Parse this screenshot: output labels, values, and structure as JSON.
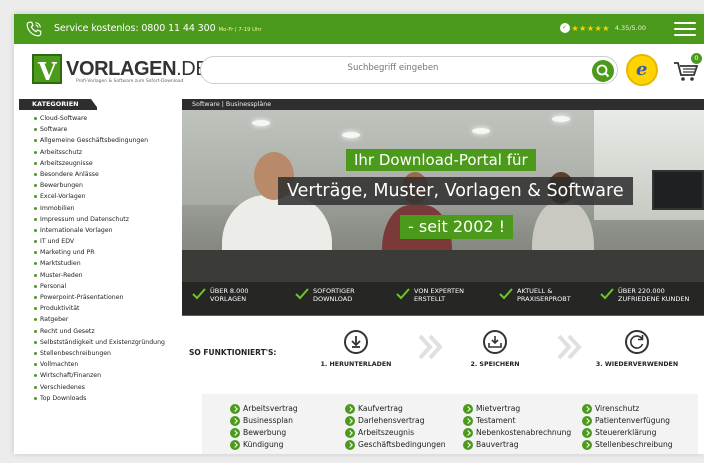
{
  "topbar": {
    "service_text": "Service kostenlos: 0800 11 44 300",
    "service_hours": "Mo-Fr | 7-19 Uhr",
    "rating_stars": "★★★★★",
    "rating_score": "4.35/5.00"
  },
  "header": {
    "logo_text": "VORLAGEN",
    "logo_tld": ".DE",
    "logo_tagline": "Profi-Vorlagen & Software zum Sofort-Download",
    "search_placeholder": "Suchbegriff eingeben",
    "trust_badge": "e",
    "cart_count": "0"
  },
  "sidebar": {
    "heading": "KATEGORIEN",
    "items": [
      "Cloud-Software",
      "Software",
      "Allgemeine Geschäftsbedingungen",
      "Arbeitsschutz",
      "Arbeitszeugnisse",
      "Besondere Anlässe",
      "Bewerbungen",
      "Excel-Vorlagen",
      "Immobilien",
      "Impressum und Datenschutz",
      "Internationale Vorlagen",
      "IT und EDV",
      "Marketing und PR",
      "Marktstudien",
      "Muster-Reden",
      "Personal",
      "Powerpoint-Präsentationen",
      "Produktivität",
      "Ratgeber",
      "Recht und Gesetz",
      "Selbstständigkeit und Existenzgründung",
      "Stellenbeschreibungen",
      "Vollmachten",
      "Wirtschaft/Finanzen",
      "Verschiedenes",
      "Top Downloads"
    ]
  },
  "breadcrumb": "Software | Businesspläne",
  "hero": {
    "line1": "Ihr Download-Portal für",
    "line2": "Verträge, Muster, Vorlagen & Software",
    "line3": "- seit 2002 !"
  },
  "usps": [
    {
      "line1": "ÜBER 8.000",
      "line2": "VORLAGEN"
    },
    {
      "line1": "SOFORTIGER",
      "line2": "DOWNLOAD"
    },
    {
      "line1": "VON EXPERTEN",
      "line2": "ERSTELLT"
    },
    {
      "line1": "AKTUELL &",
      "line2": "PRAXISERPROBT"
    },
    {
      "line1": "ÜBER 220.000",
      "line2": "ZUFRIEDENE KUNDEN"
    }
  ],
  "howto": {
    "label": "SO FUNKTIONIERT'S:",
    "steps": [
      "1. HERUNTERLADEN",
      "2. SPEICHERN",
      "3. WIEDERVERWENDEN"
    ]
  },
  "links": [
    [
      "Arbeitsvertrag",
      "Kaufvertrag",
      "Mietvertrag",
      "Virenschutz"
    ],
    [
      "Businessplan",
      "Darlehensvertrag",
      "Testament",
      "Patientenverfügung"
    ],
    [
      "Bewerbung",
      "Arbeitszeugnis",
      "Nebenkostenabrechnung",
      "Steuererklärung"
    ],
    [
      "Kündigung",
      "Geschäftsbedingungen",
      "Bauvertrag",
      "Stellenbeschreibung"
    ]
  ],
  "colors": {
    "brand_green": "#4c9a1c",
    "dark_bar": "#2e2e2e"
  }
}
